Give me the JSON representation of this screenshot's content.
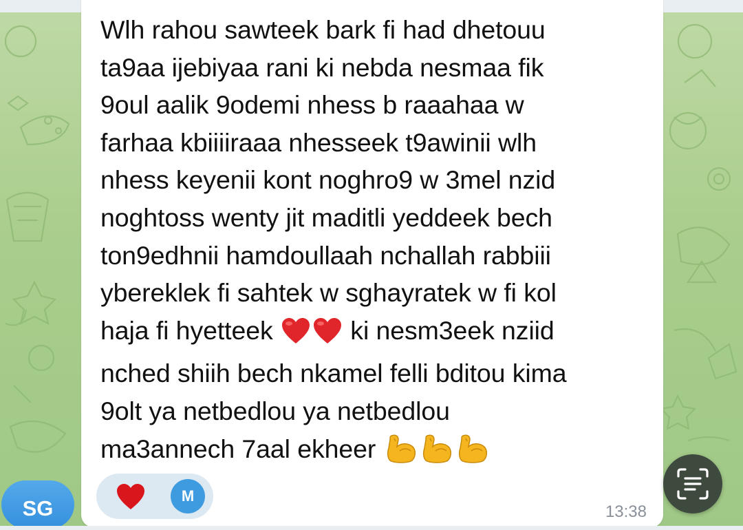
{
  "message": {
    "lines": [
      "Wlh rahou sawteek bark fi had dhetouu",
      "ta9aa ijebiyaa rani ki nebda nesmaa fik",
      "9oul aalik 9odemi nhess b raaahaa w",
      "farhaa kbiiiiraaa nhesseek t9awinii wlh",
      "nhess keyenii kont  noghro9 w 3mel nzid",
      "noghtoss wenty jit maditli yeddeek bech",
      "ton9edhnii hamdoullaah nchallah rabbiii",
      "ybereklek fi sahtek w sghayratek w fi kol"
    ],
    "line9_before": "haja fi hyetteek",
    "line9_emojis": [
      "red-heart",
      "red-heart"
    ],
    "line9_after": " ki nesm3eek nziid",
    "lines_after": [
      "nched shiih bech nkamel felli bditou kima",
      "9olt ya netbedlou ya netbedlou"
    ],
    "line12_text": "ma3annech 7aal ekheer",
    "line12_emojis": [
      "flexed-biceps",
      "flexed-biceps",
      "flexed-biceps"
    ],
    "time": "13:38"
  },
  "reactions": {
    "emoji": "red-heart",
    "user_initial": "M",
    "user_color": "#3f9be0"
  },
  "sender": {
    "initials": "SG",
    "color": "#3f95e0"
  },
  "actions": {
    "scan_icon": "text-scan-icon"
  },
  "colors": {
    "wallpaper": "#a9cd8c",
    "bubble": "#ffffff",
    "reaction_pill": "#dde9f2",
    "timestamp": "#8a9099"
  }
}
